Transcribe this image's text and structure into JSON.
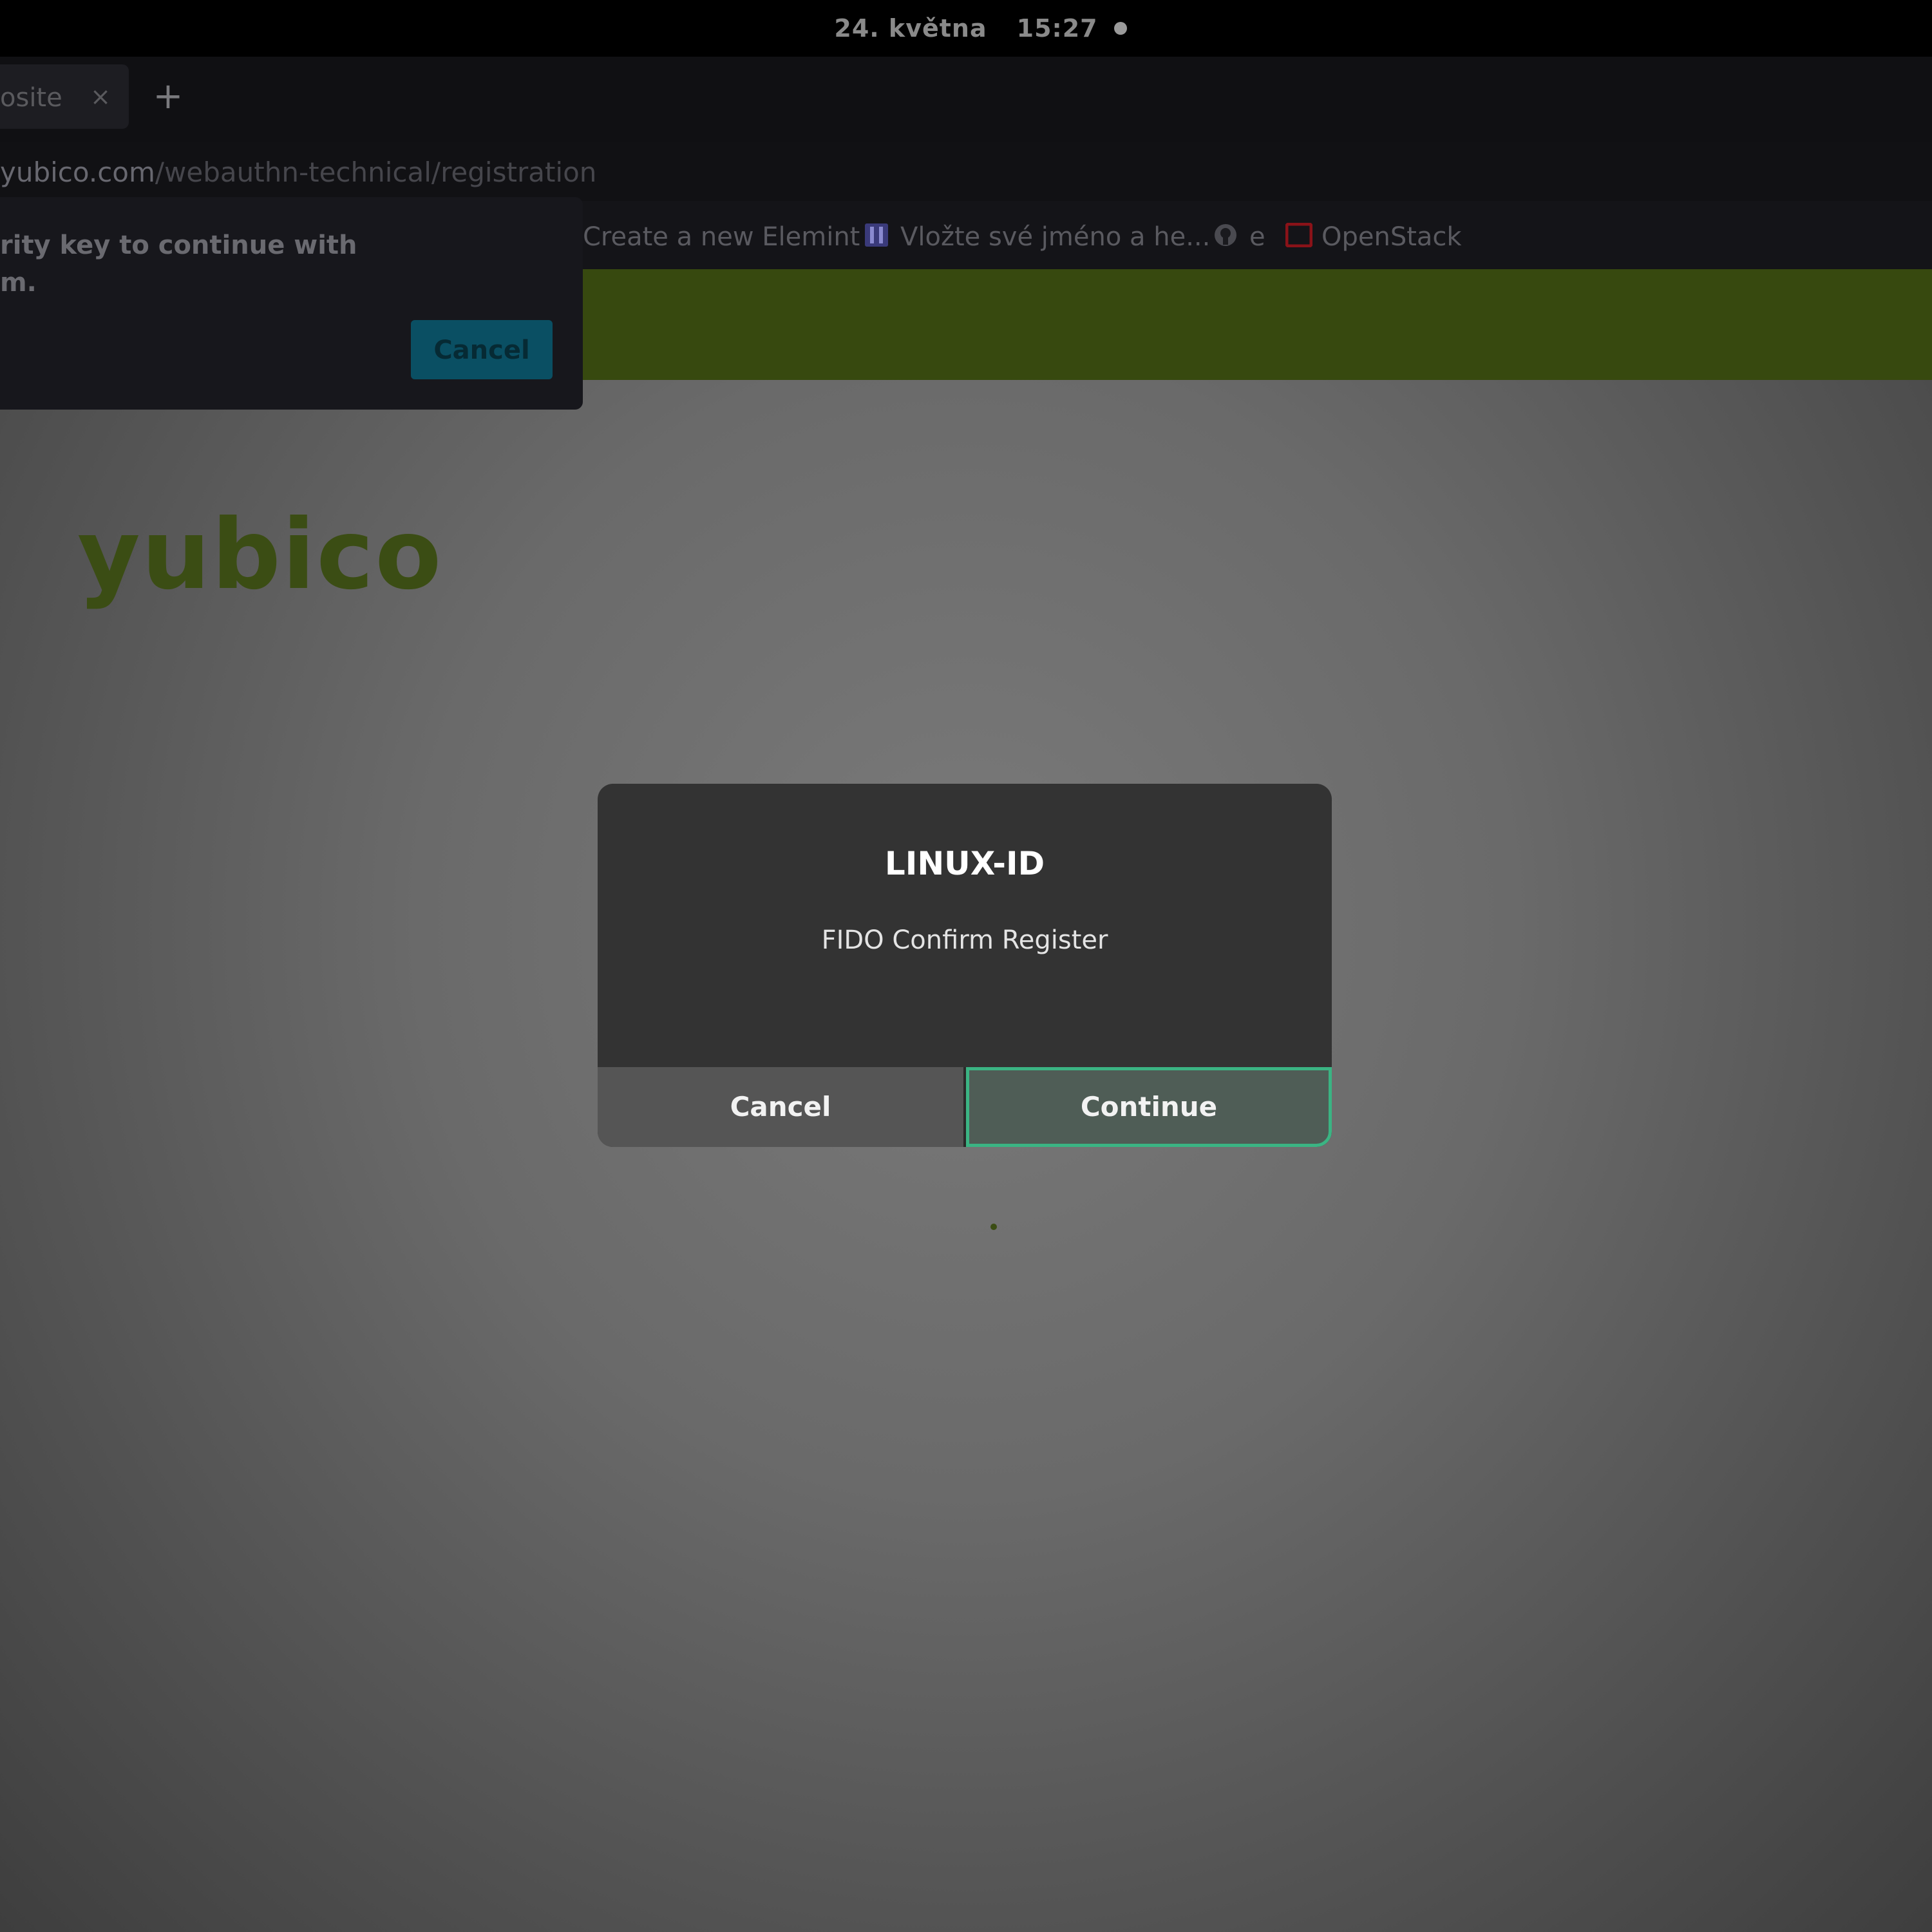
{
  "topbar": {
    "date": "24. května",
    "time": "15:27"
  },
  "browser": {
    "tab": {
      "title": "osite",
      "close_glyph": "×"
    },
    "new_tab_glyph": "+",
    "url": {
      "host": "yubico.com",
      "path": "/webauthn-technical/registration"
    },
    "bookmarks": [
      {
        "label": "Create a new Elemint"
      },
      {
        "label": "Vložte své jméno a he..."
      },
      {
        "label": "e"
      },
      {
        "label": "OpenStack"
      }
    ]
  },
  "page": {
    "logo": "yubico"
  },
  "security_prompt": {
    "line1": "rity key to continue with",
    "line2": "m.",
    "cancel_label": "Cancel"
  },
  "dialog": {
    "title": "LINUX-ID",
    "message": "FIDO Confirm Register",
    "cancel_label": "Cancel",
    "continue_label": "Continue"
  },
  "colors": {
    "dialog_bg": "#333333",
    "continue_border": "#3bb483",
    "banner_green": "#37490f",
    "popup_button": "#0a4f63",
    "openstack_red": "#b2121a"
  }
}
